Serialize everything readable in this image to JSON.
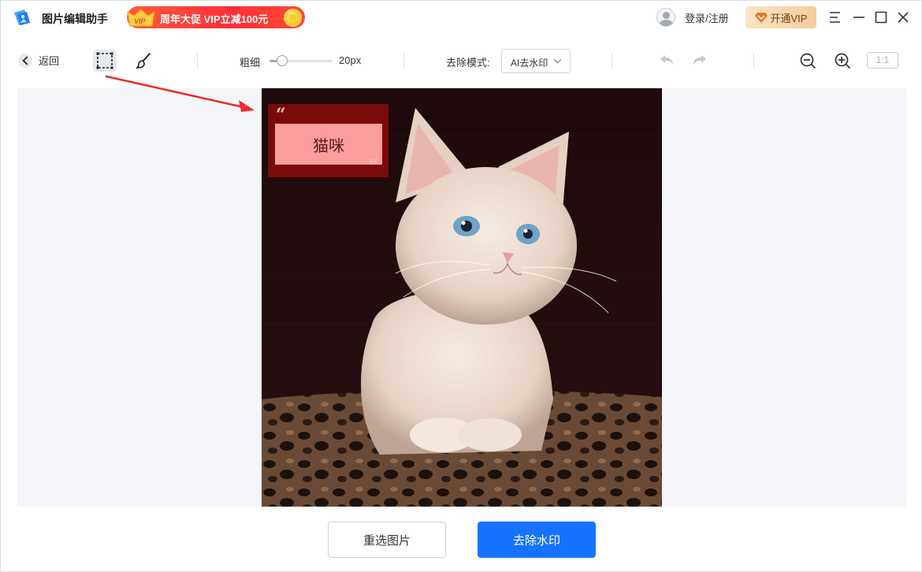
{
  "app": {
    "title": "图片编辑助手",
    "promo_badge": "VIP",
    "promo_text": "周年大促 VIP立减100元",
    "login_text": "登录/注册",
    "vip_button": "开通VIP"
  },
  "window_controls": [
    "menu-icon",
    "minimize-icon",
    "maximize-icon",
    "close-icon"
  ],
  "toolbar": {
    "back_label": "返回",
    "tools": [
      "rect-select-icon",
      "brush-icon"
    ],
    "thickness_label": "粗细",
    "thickness_value": "20px",
    "thickness_level": 0.2,
    "mode_label": "去除模式:",
    "mode_value": "AI去水印",
    "ratio_label": "1:1"
  },
  "image": {
    "watermark_text": "猫咪",
    "watermark_open_quote": "“",
    "watermark_close_quote": "”"
  },
  "buttons": {
    "reselect": "重选图片",
    "remove": "去除水印"
  },
  "colors": {
    "primary": "#1673ff",
    "promo": "#ff2d3a",
    "vip_gold": "#f7cc99",
    "arrow": "#ef2b2b",
    "watermark_outer": "#7a0b0b",
    "watermark_inner": "#fa9d9d"
  }
}
